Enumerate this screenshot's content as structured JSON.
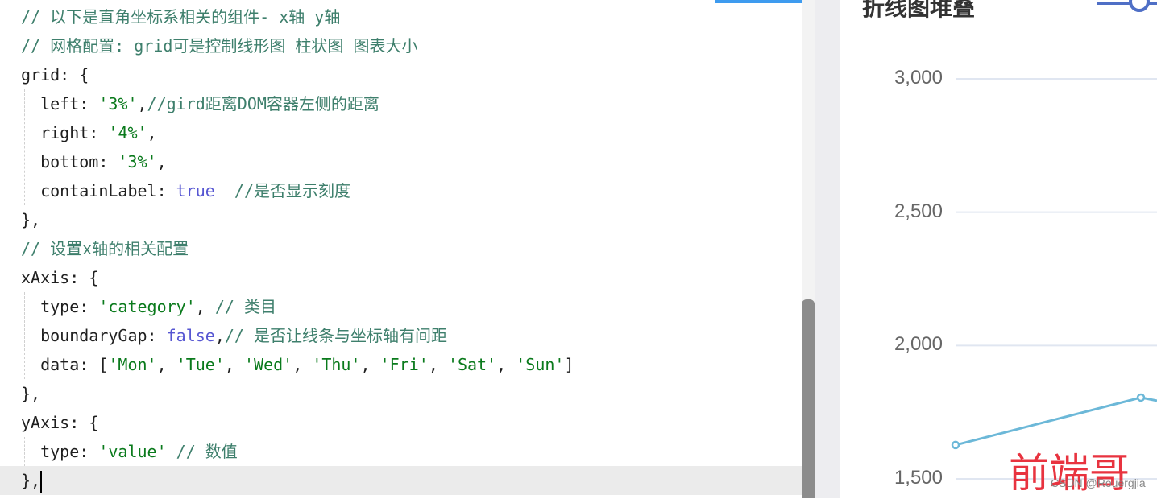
{
  "editor": {
    "lines": [
      [
        [
          "comment",
          "// 以下是直角坐标系相关的组件- x轴 y轴"
        ]
      ],
      [
        [
          "comment",
          "// 网格配置: grid可是控制线形图 柱状图 图表大小"
        ]
      ],
      [
        [
          "plain",
          "grid: {"
        ]
      ],
      [
        [
          "plain",
          "  left: "
        ],
        [
          "string",
          "'3%'"
        ],
        [
          "plain",
          ","
        ],
        [
          "comment",
          "//gird距离DOM容器左侧的距离"
        ]
      ],
      [
        [
          "plain",
          "  right: "
        ],
        [
          "string",
          "'4%'"
        ],
        [
          "plain",
          ","
        ]
      ],
      [
        [
          "plain",
          "  bottom: "
        ],
        [
          "string",
          "'3%'"
        ],
        [
          "plain",
          ","
        ]
      ],
      [
        [
          "plain",
          "  containLabel: "
        ],
        [
          "kw",
          "true"
        ],
        [
          "plain",
          "  "
        ],
        [
          "comment",
          "//是否显示刻度"
        ]
      ],
      [
        [
          "plain",
          "},"
        ]
      ],
      [
        [
          "comment",
          "// 设置x轴的相关配置"
        ]
      ],
      [
        [
          "plain",
          "xAxis: {"
        ]
      ],
      [
        [
          "plain",
          "  type: "
        ],
        [
          "string",
          "'category'"
        ],
        [
          "plain",
          ", "
        ],
        [
          "comment",
          "// 类目"
        ]
      ],
      [
        [
          "plain",
          "  boundaryGap: "
        ],
        [
          "kw",
          "false"
        ],
        [
          "plain",
          ","
        ],
        [
          "comment",
          "// 是否让线条与坐标轴有间距"
        ]
      ],
      [
        [
          "plain",
          "  data: ["
        ],
        [
          "string",
          "'Mon'"
        ],
        [
          "plain",
          ", "
        ],
        [
          "string",
          "'Tue'"
        ],
        [
          "plain",
          ", "
        ],
        [
          "string",
          "'Wed'"
        ],
        [
          "plain",
          ", "
        ],
        [
          "string",
          "'Thu'"
        ],
        [
          "plain",
          ", "
        ],
        [
          "string",
          "'Fri'"
        ],
        [
          "plain",
          ", "
        ],
        [
          "string",
          "'Sat'"
        ],
        [
          "plain",
          ", "
        ],
        [
          "string",
          "'Sun'"
        ],
        [
          "plain",
          "]"
        ]
      ],
      [
        [
          "plain",
          "},"
        ]
      ],
      [
        [
          "plain",
          "yAxis: {"
        ]
      ],
      [
        [
          "plain",
          "  type: "
        ],
        [
          "string",
          "'value'"
        ],
        [
          "plain",
          " "
        ],
        [
          "comment",
          "// 数值"
        ]
      ],
      [
        [
          "plain",
          "},"
        ]
      ]
    ]
  },
  "chart": {
    "title": "折线图堆叠",
    "y_ticks": [
      "3,000",
      "2,500",
      "2,000",
      "1,500"
    ],
    "y_values": [
      3000,
      2500,
      2000,
      1500
    ],
    "series_points": [
      1627,
      1805
    ],
    "line_color": "#6cb8d8",
    "legend_color": "#4f6fc6",
    "watermark": "前端哥",
    "credit": "CSDN @Rouergjia"
  }
}
